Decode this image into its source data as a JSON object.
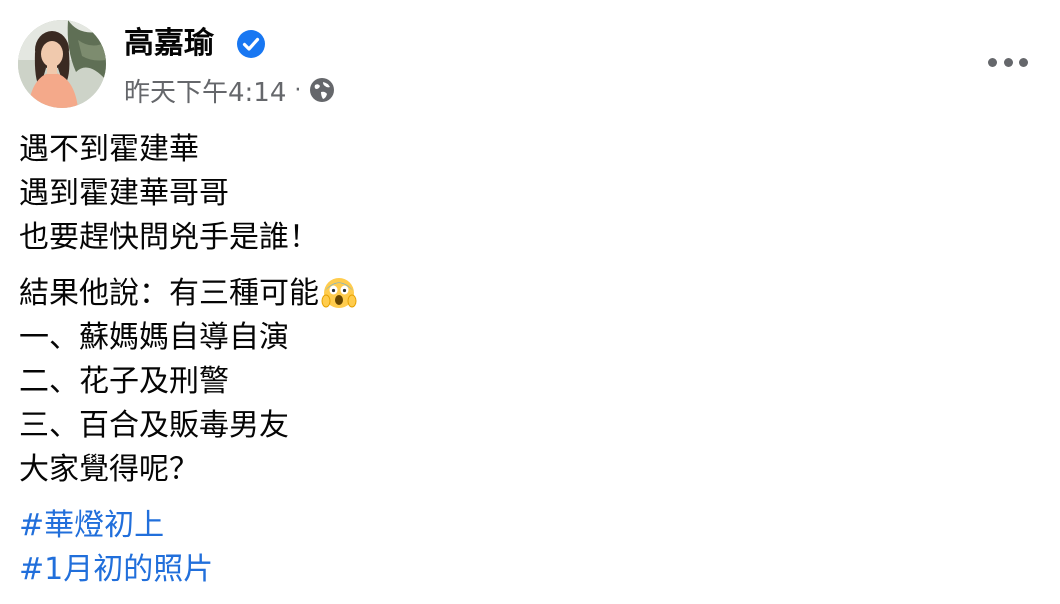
{
  "post": {
    "author": "高嘉瑜",
    "timestamp": "昨天下午4:14",
    "separator": "·",
    "verified_icon": "verified-badge-icon",
    "audience_icon": "globe-icon",
    "more_icon": "more-options-icon",
    "colors": {
      "verified": "#1877f2",
      "meta_text": "#65676b",
      "hashtag": "#216fdb"
    },
    "paragraphs": [
      [
        "遇不到霍建華",
        "遇到霍建華哥哥",
        "也要趕快問兇手是誰！"
      ],
      [
        "結果他說：有三種可能",
        "一、蘇媽媽自導自演",
        "二、花子及刑警",
        "三、百合及販毒男友",
        "大家覺得呢？"
      ]
    ],
    "emoji": "screaming-face-emoji",
    "hashtags": [
      "#華燈初上",
      "#1月初的照片"
    ]
  }
}
